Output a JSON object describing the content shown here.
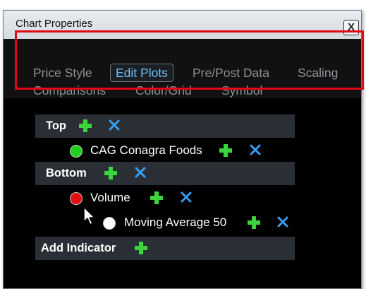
{
  "window": {
    "title": "Chart Properties",
    "close_label": "X"
  },
  "tabs": [
    {
      "label": "Price Style",
      "active": false
    },
    {
      "label": "Edit Plots",
      "active": true
    },
    {
      "label": "Pre/Post Data",
      "active": false
    },
    {
      "label": "Scaling",
      "active": false
    },
    {
      "label": "Comparisons",
      "active": false
    },
    {
      "label": "Color/Grid",
      "active": false
    },
    {
      "label": "Symbol",
      "active": false
    }
  ],
  "plots": {
    "top_section": {
      "label": "Top"
    },
    "top_items": [
      {
        "label": "CAG Conagra Foods",
        "color": "#1fd11f"
      }
    ],
    "bottom_section": {
      "label": "Bottom"
    },
    "bottom_items": [
      {
        "label": "Volume",
        "color": "#e01010"
      },
      {
        "label": "Moving Average 50",
        "color": "#ffffff"
      }
    ],
    "add_indicator_label": "Add Indicator"
  },
  "colors": {
    "highlight": "#e30613",
    "plus": "#3cd43c",
    "remove": "#3a9ef0",
    "active_tab": "#76bdf0"
  },
  "icons": [
    "add-plus-icon",
    "remove-x-icon",
    "mouse-pointer-icon"
  ]
}
